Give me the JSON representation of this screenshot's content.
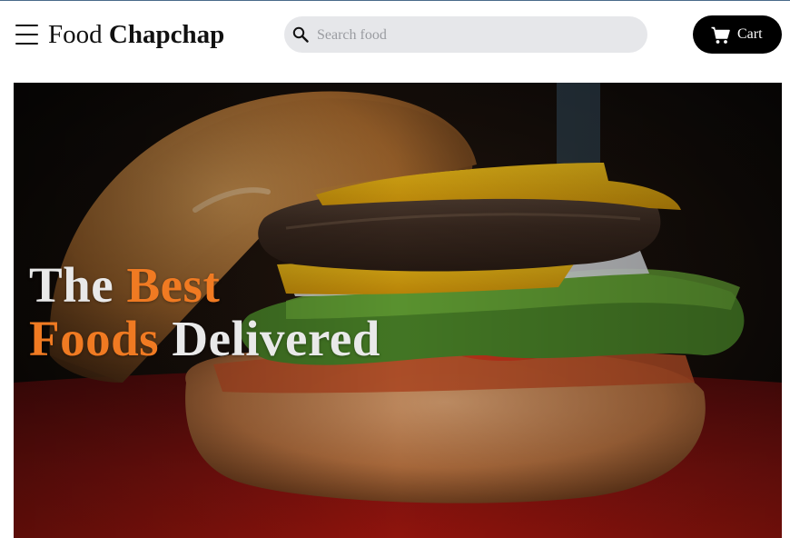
{
  "header": {
    "brand_light": "Food",
    "brand_bold": "Chapchap",
    "menu_icon": "hamburger-menu-icon",
    "search": {
      "placeholder": "Search food",
      "value": "",
      "icon": "search-icon"
    },
    "cart": {
      "label": "Cart",
      "icon": "cart-icon"
    }
  },
  "hero": {
    "image": "burger-photo",
    "title": {
      "part1": "The",
      "part2": "Best",
      "part3": "Foods",
      "part4": "Delivered"
    },
    "accent_color": "#f07a22"
  }
}
